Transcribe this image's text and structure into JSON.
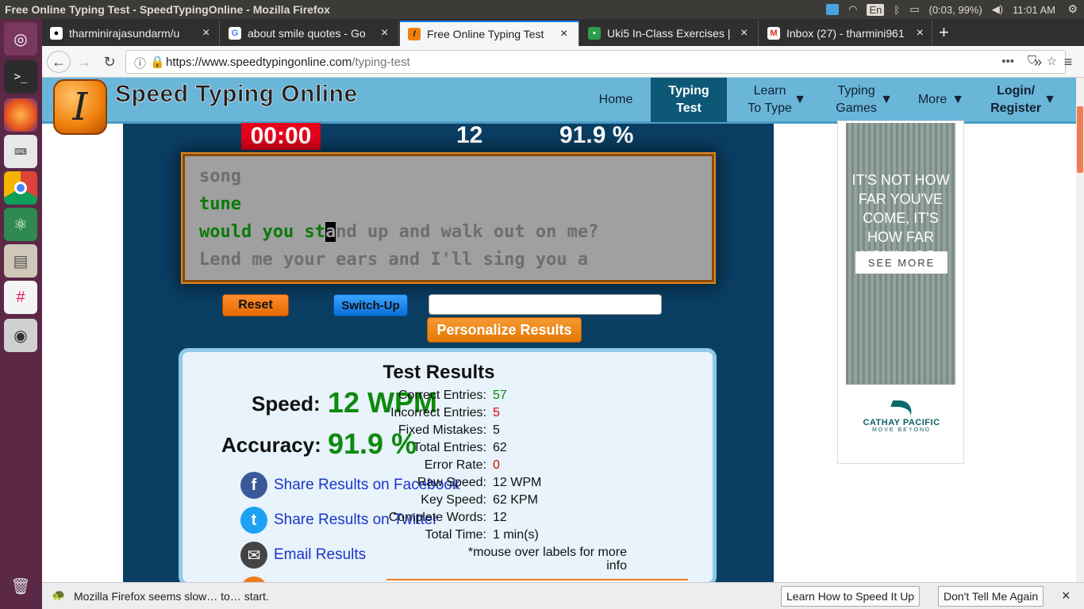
{
  "os": {
    "window_title": "Free Online Typing Test - SpeedTypingOnline - Mozilla Firefox",
    "input_indicator": "En",
    "battery": "(0:03, 99%)",
    "clock": "11:01 AM"
  },
  "browser": {
    "tabs": [
      {
        "label": "tharminirajasundarm/u",
        "icon": "github-icon"
      },
      {
        "label": "about smile quotes - Go",
        "icon": "google-icon"
      },
      {
        "label": "Free Online Typing Test",
        "icon": "speedtyping-icon"
      },
      {
        "label": "Uki5 In-Class Exercises |",
        "icon": "classroom-icon"
      },
      {
        "label": "Inbox (27) - tharmini961",
        "icon": "gmail-icon"
      }
    ],
    "url_host": "https://www.speedtypingonline.com",
    "url_path": "/typing-test",
    "url_actions": "•••"
  },
  "site": {
    "name": "Speed Typing Online",
    "logo_letter": "I",
    "menu": [
      {
        "label": "Home"
      },
      {
        "label": "Typing Test"
      },
      {
        "label": "Learn To Type"
      },
      {
        "label": "Typing Games"
      },
      {
        "label": "More"
      },
      {
        "label": "Login/ Register"
      }
    ]
  },
  "test": {
    "timer": "00:00",
    "wpm": "12",
    "accuracy": "91.9 %",
    "lines": {
      "l1": "song",
      "l2": "tune",
      "l3_typed": "would you st",
      "l3_cursor": "a",
      "l3_rest": "nd up and walk out on me?",
      "l4": "Lend me your ears and I'll sing you a"
    },
    "reset_label": "Reset",
    "switch_label": "Switch-Up",
    "personalize_label": "Personalize Results"
  },
  "results": {
    "title": "Test Results",
    "speed_label": "Speed:",
    "speed_value": "12 WPM",
    "accuracy_label": "Accuracy:",
    "accuracy_value": "91.9 %",
    "share": [
      {
        "label": "Share Results on Facebook",
        "icon": "facebook-icon"
      },
      {
        "label": "Share Results on Twitter",
        "icon": "twitter-icon"
      },
      {
        "label": "Email Results",
        "icon": "email-icon"
      }
    ],
    "stats": [
      {
        "label": "Correct Entries:",
        "value": "57",
        "color": "green"
      },
      {
        "label": "Incorrect Entries:",
        "value": "5",
        "color": "red"
      },
      {
        "label": "Fixed Mistakes:",
        "value": "5",
        "color": "black"
      },
      {
        "label": "Total Entries:",
        "value": "62",
        "color": "black"
      },
      {
        "label": "Error Rate:",
        "value": "0",
        "color": "red"
      },
      {
        "label": "Raw Speed:",
        "value": "12 WPM",
        "color": "black"
      },
      {
        "label": "Key Speed:",
        "value": "62 KPM",
        "color": "black"
      },
      {
        "label": "Complete Words:",
        "value": "12",
        "color": "black"
      },
      {
        "label": "Total Time:",
        "value": "1 min(s)",
        "color": "black"
      }
    ],
    "footnote": "*mouse over labels for more info"
  },
  "ad": {
    "headline": "IT'S NOT HOW FAR YOU'VE COME, IT'S HOW FAR YOU'LL GO.",
    "cta": "SEE MORE",
    "brand": "CATHAY PACIFIC",
    "slogan": "MOVE BEYOND"
  },
  "notification": {
    "text": "Mozilla Firefox seems slow… to… start.",
    "learn_label": "Learn How to Speed It Up",
    "dismiss_label": "Don't Tell Me Again"
  },
  "colors": {
    "header_bg": "#6ab6d9",
    "game_bg": "#0a3e63",
    "timer_bg": "#e8001b",
    "typed_text": "#0a7a0a",
    "accent_orange": "#e47800"
  }
}
